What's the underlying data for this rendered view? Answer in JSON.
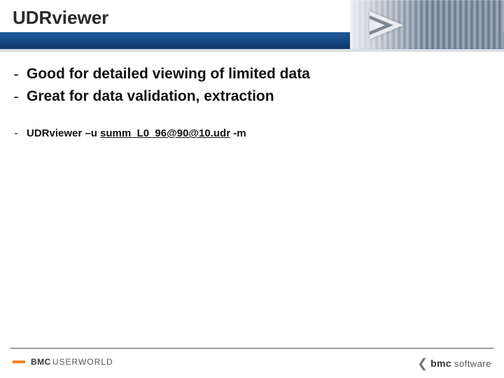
{
  "header": {
    "title": "UDRviewer"
  },
  "bullets": {
    "point1": "Good for detailed viewing of limited data",
    "point2": "Great for data validation, extraction"
  },
  "command": {
    "prefix": "UDRviewer –u ",
    "linked": "summ_L0_96@90@10.udr",
    "suffix": " -m"
  },
  "footer": {
    "brand_left_strong": "BMC",
    "brand_left_rest": "USERWORLD",
    "brand_right_strong": "bmc",
    "brand_right_rest": "software"
  }
}
